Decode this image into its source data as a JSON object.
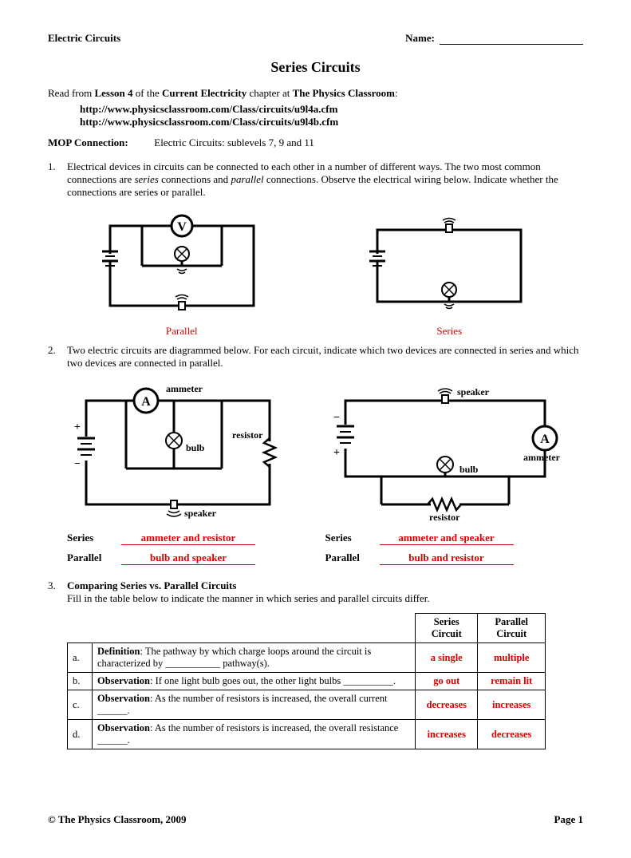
{
  "header": {
    "subject": "Electric Circuits",
    "name_label": "Name:"
  },
  "title": "Series Circuits",
  "intro": {
    "prefix": "Read from ",
    "lesson": "Lesson 4",
    "mid": " of the ",
    "chapter": "Current Electricity",
    "suffix": " chapter at ",
    "site": "The Physics Classroom",
    "colon": ":"
  },
  "urls": [
    "http://www.physicsclassroom.com/Class/circuits/u9l4a.cfm",
    "http://www.physicsclassroom.com/Class/circuits/u9l4b.cfm"
  ],
  "mop": {
    "label": "MOP Connection:",
    "text": "Electric Circuits:  sublevels 7, 9 and 11"
  },
  "q1": {
    "num": "1.",
    "text_a": "Electrical devices in circuits can be connected to each other in a number of different ways.  The two most common connections are ",
    "series_word": "series",
    "text_b": " connections and ",
    "parallel_word": "parallel",
    "text_c": " connections.  Observe the electrical wiring below.  Indicate whether the connections are series or parallel.",
    "label_left": "Parallel",
    "label_right": "Series"
  },
  "q2": {
    "num": "2.",
    "text": "Two electric circuits are diagrammed below.  For each circuit, indicate which two devices are connected in series and which two devices are connected in parallel.",
    "labels": {
      "ammeter": "ammeter",
      "bulb": "bulb",
      "resistor": "resistor",
      "speaker": "speaker"
    },
    "answers_left": {
      "series_label": "Series",
      "series_ans": "ammeter and resistor",
      "parallel_label": "Parallel",
      "parallel_ans": "bulb and speaker"
    },
    "answers_right": {
      "series_label": "Series",
      "series_ans": "ammeter and speaker",
      "parallel_label": "Parallel",
      "parallel_ans": "bulb and resistor"
    }
  },
  "q3": {
    "num": "3.",
    "heading": "Comparing Series vs. Parallel Circuits",
    "text": "Fill in the table below to indicate the manner in which series and parallel circuits differ.",
    "cols": {
      "series": "Series Circuit",
      "parallel": "Parallel Circuit"
    },
    "rows": [
      {
        "letter": "a.",
        "desc_bold": "Definition",
        "desc": ":  The pathway by which charge loops around the circuit is characterized by ___________ pathway(s).",
        "series": "a single",
        "parallel": "multiple"
      },
      {
        "letter": "b.",
        "desc_bold": "Observation",
        "desc": ":  If one light bulb goes out, the other light bulbs __________.",
        "series": "go out",
        "parallel": "remain lit"
      },
      {
        "letter": "c.",
        "desc_bold": "Observation",
        "desc": ":  As the number of resistors is increased, the overall current ______.",
        "series": "decreases",
        "parallel": "increases"
      },
      {
        "letter": "d.",
        "desc_bold": "Observation",
        "desc": ":  As the number of resistors is increased, the overall resistance ______.",
        "series": "increases",
        "parallel": "decreases"
      }
    ]
  },
  "footer": {
    "copyright": "©  The Physics Classroom, 2009",
    "page": "Page 1"
  }
}
